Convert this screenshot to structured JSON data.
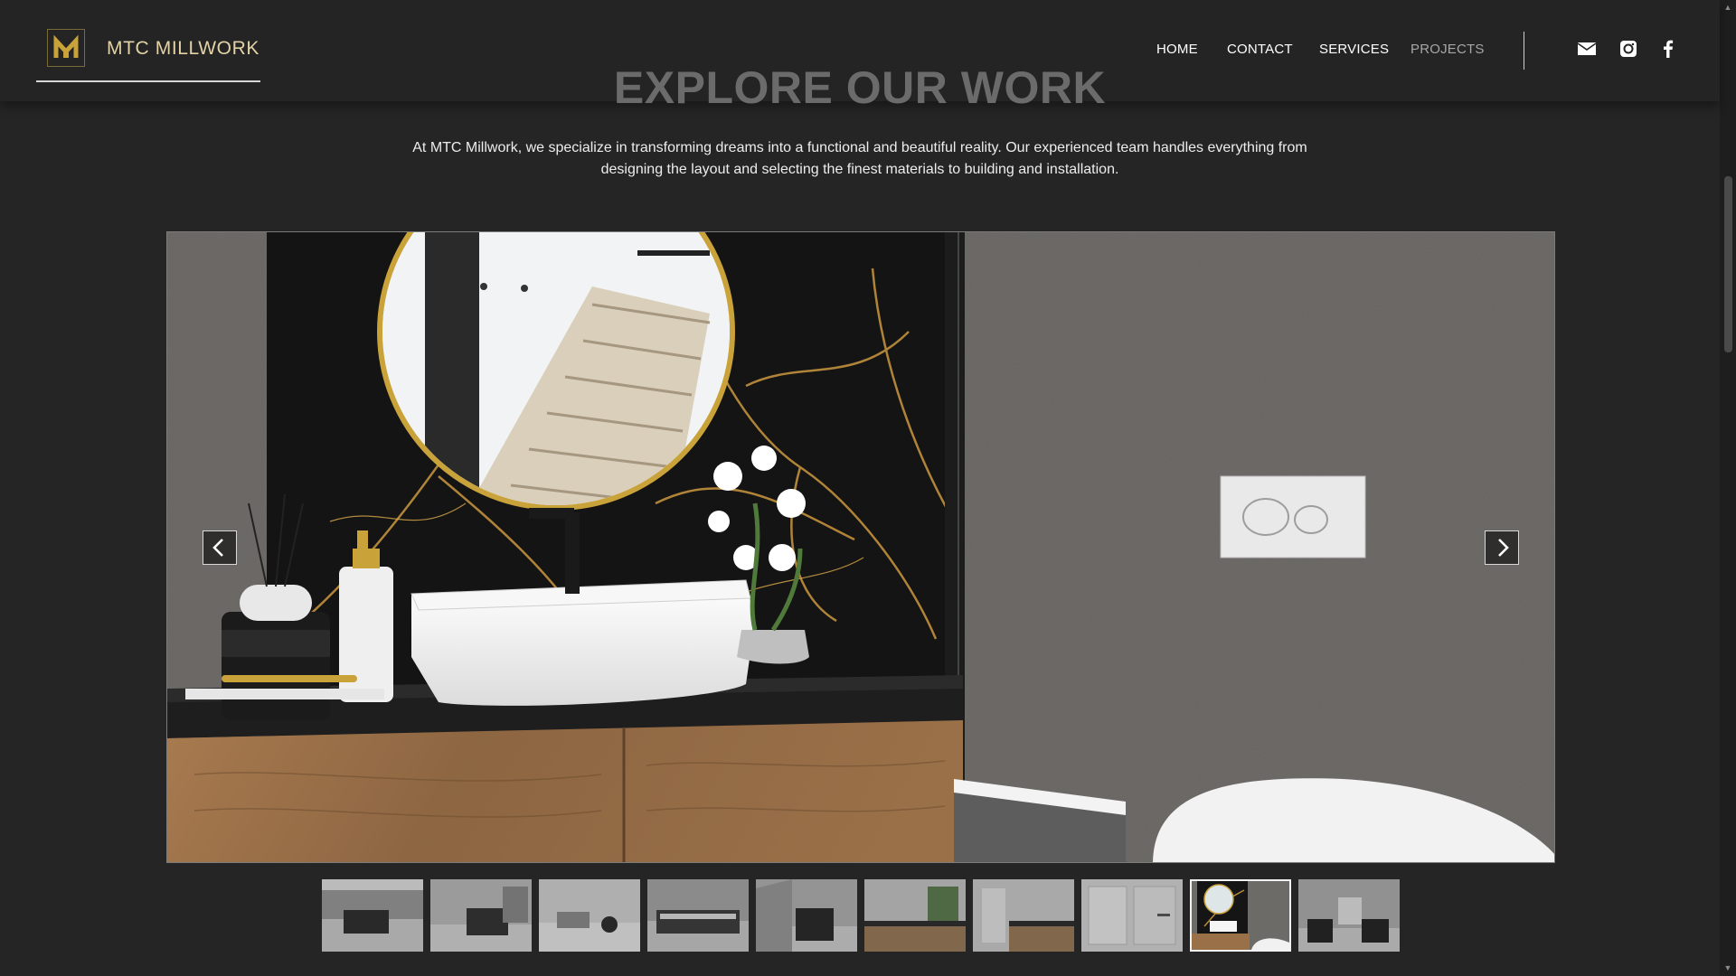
{
  "brand": {
    "name": "MTC MILLWORK",
    "accent": "#c9a23a"
  },
  "nav": [
    {
      "label": "HOME",
      "active": false
    },
    {
      "label": "CONTACT",
      "active": false
    },
    {
      "label": "SERVICES",
      "active": false
    },
    {
      "label": "PROJECTS",
      "active": true
    }
  ],
  "social": [
    "mail-icon",
    "instagram-icon",
    "facebook-icon"
  ],
  "page": {
    "heading": "EXPLORE OUR WORK",
    "intro": "At MTC Millwork, we specialize in transforming dreams into a functional and beautiful reality. Our experienced team handles everything from designing the layout and selecting the finest materials to building and installation."
  },
  "gallery": {
    "thumbnail_count": 10,
    "active_thumbnail": 9,
    "prev_icon": "chevron-left-icon",
    "next_icon": "chevron-right-icon"
  }
}
